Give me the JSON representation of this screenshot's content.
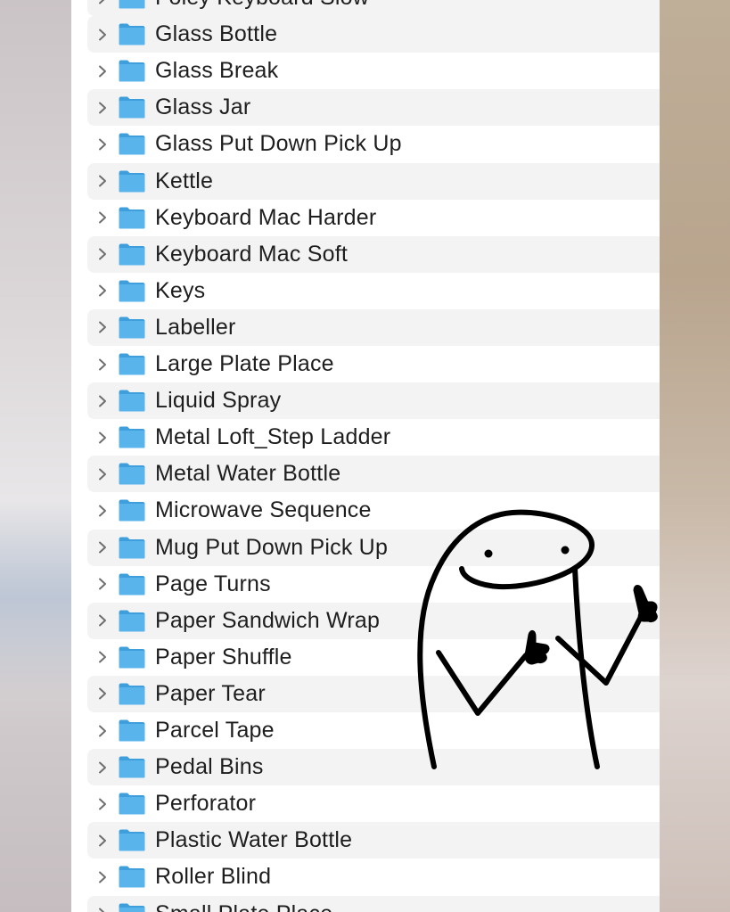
{
  "folder_list": {
    "items": [
      {
        "label": "Foley Keyboard Slow",
        "alt": true
      },
      {
        "label": "Glass Bottle",
        "alt": true
      },
      {
        "label": "Glass Break",
        "alt": false
      },
      {
        "label": "Glass Jar",
        "alt": true
      },
      {
        "label": "Glass Put Down Pick Up",
        "alt": false
      },
      {
        "label": "Kettle",
        "alt": true
      },
      {
        "label": "Keyboard Mac Harder",
        "alt": false
      },
      {
        "label": "Keyboard Mac Soft",
        "alt": true
      },
      {
        "label": "Keys",
        "alt": false
      },
      {
        "label": "Labeller",
        "alt": true
      },
      {
        "label": "Large Plate Place",
        "alt": false
      },
      {
        "label": "Liquid Spray",
        "alt": true
      },
      {
        "label": "Metal Loft_Step Ladder",
        "alt": false
      },
      {
        "label": "Metal Water Bottle",
        "alt": true
      },
      {
        "label": "Microwave Sequence",
        "alt": false
      },
      {
        "label": "Mug Put Down Pick Up",
        "alt": true
      },
      {
        "label": "Page Turns",
        "alt": false
      },
      {
        "label": "Paper Sandwich Wrap",
        "alt": true
      },
      {
        "label": "Paper Shuffle",
        "alt": false
      },
      {
        "label": "Paper Tear",
        "alt": true
      },
      {
        "label": "Parcel Tape",
        "alt": false
      },
      {
        "label": "Pedal Bins",
        "alt": true
      },
      {
        "label": "Perforator",
        "alt": false
      },
      {
        "label": "Plastic Water Bottle",
        "alt": true
      },
      {
        "label": "Roller Blind",
        "alt": false
      },
      {
        "label": "Small Plate Place",
        "alt": true
      }
    ],
    "icons": {
      "expander": "chevron-right-icon",
      "folder": "folder-icon"
    },
    "colors": {
      "folder_blue": "#5ab4ec",
      "folder_tab": "#3f9fdc",
      "row_alt": "#f3f3f3",
      "chevron": "#6e6e6e"
    }
  },
  "overlay": {
    "sticker": "thumbs-up-doodle"
  }
}
